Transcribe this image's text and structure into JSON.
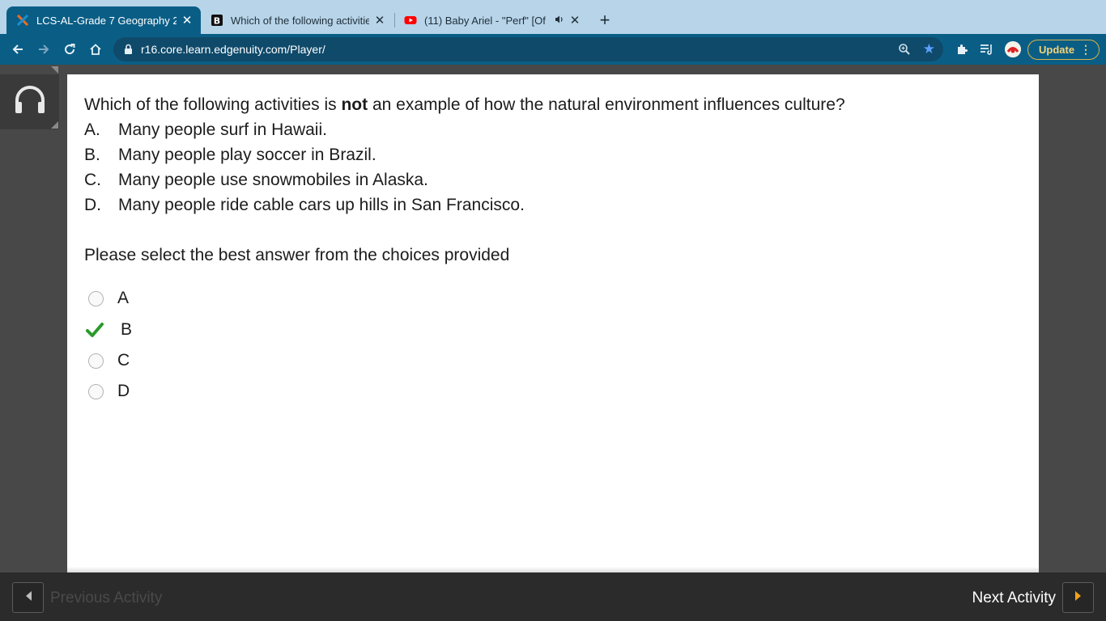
{
  "browser": {
    "tabs": [
      {
        "title": "LCS-AL-Grade 7 Geography 2(",
        "favicon": "edgenuity-x-icon",
        "active": true
      },
      {
        "title": "Which of the following activitie",
        "favicon": "brainly-b-icon",
        "active": false
      },
      {
        "title": "(11) Baby Ariel - \"Perf\" [Of",
        "favicon": "youtube-icon",
        "active": false,
        "audio": true
      }
    ],
    "url": "r16.core.learn.edgenuity.com/Player/",
    "update_label": "Update",
    "colors": {
      "tabstrip": "#b8d4e9",
      "toolbar": "#0a5e86",
      "update_accent": "#f4d37a"
    }
  },
  "question": {
    "text_before": "Which of the following activities is ",
    "text_bold": "not",
    "text_after": " an example of how the natural environment influences culture?",
    "choices": [
      {
        "letter": "A.",
        "text": "Many people surf in Hawaii."
      },
      {
        "letter": "B.",
        "text": "Many people play soccer in Brazil."
      },
      {
        "letter": "C.",
        "text": "Many people use snowmobiles in Alaska."
      },
      {
        "letter": "D.",
        "text": "Many people ride cable cars up hills in San Francisco."
      }
    ],
    "instruction": "Please select the best answer from the choices provided"
  },
  "answers": [
    {
      "label": "A",
      "state": "unselected"
    },
    {
      "label": "B",
      "state": "correct",
      "icon": "checkmark-icon",
      "color": "#2a9a2a"
    },
    {
      "label": "C",
      "state": "unselected"
    },
    {
      "label": "D",
      "state": "unselected"
    }
  ],
  "footer": {
    "previous_label": "Previous Activity",
    "next_label": "Next Activity",
    "next_arrow_color": "#f2a21b"
  }
}
